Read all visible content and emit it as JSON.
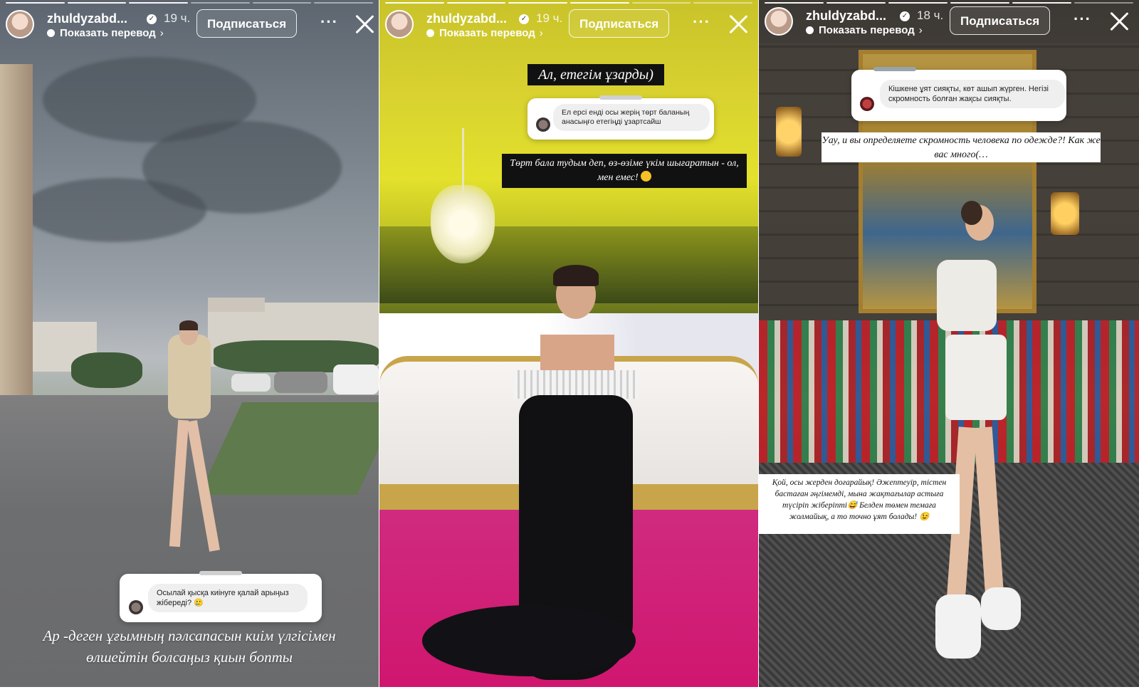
{
  "stories": [
    {
      "username": "zhuldyzabd...",
      "time": "19 ч.",
      "translate_label": "Показать перевод",
      "follow_label": "Подписаться",
      "more_label": "···",
      "question": "Осылай қысқа киінуге қалай арыңыз жібереді? 🥲",
      "caption": "Ар -деген ұғымның пәлсапасын киім үлгісімен өлшейтін болсаңыз қиын бопты"
    },
    {
      "username": "zhuldyzabd...",
      "time": "19 ч.",
      "translate_label": "Показать перевод",
      "follow_label": "Подписаться",
      "more_label": "···",
      "caption_top": "Ал, етегім ұзарды)",
      "question": "Ел ерсі енді осы жерің төрт баланың анасыңғо етегіңді ұзартсайш",
      "caption": "Төрт бала тудым деп, өз-өзіме үкім шығаратын - ол, мен емес!"
    },
    {
      "username": "zhuldyzabd...",
      "time": "18 ч.",
      "translate_label": "Показать перевод",
      "follow_label": "Подписаться",
      "more_label": "···",
      "question": "Кішкене ұят сияқты, көт ашып жүрген. Негізі скромность болған жақсы сияқты.",
      "caption_top": "Уау, и вы определяете скромность человека по одежде?! Как же вас много(…",
      "caption": "Қой, осы жерден доғарайық! Әжептеуір, тістен бастаған әңгімемді, мына жақтағылар астыға түсіріп жіберіпті😅 Белден төмен темаға жолмайық, а то точно ұят болады! 😉"
    }
  ],
  "colors": {
    "accent_white": "#ffffff",
    "caption_black": "#111111"
  }
}
